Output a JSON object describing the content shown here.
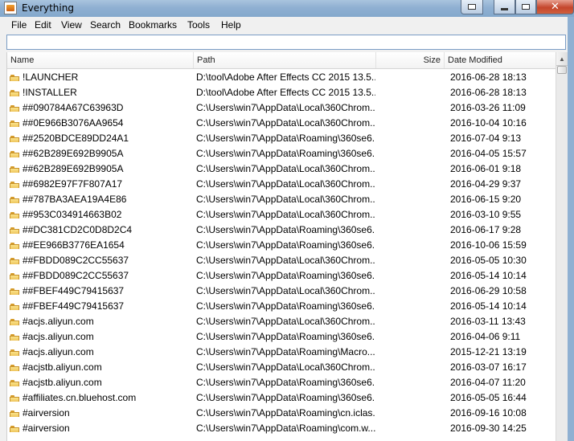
{
  "window": {
    "title": "Everything"
  },
  "menu": [
    "File",
    "Edit",
    "View",
    "Search",
    "Bookmarks",
    "Tools",
    "Help"
  ],
  "search": {
    "value": "",
    "placeholder": ""
  },
  "columns": {
    "name": "Name",
    "path": "Path",
    "size": "Size",
    "date": "Date Modified"
  },
  "rows": [
    {
      "name": "!LAUNCHER",
      "path": "D:\\tool\\Adobe After Effects CC 2015 13.5...",
      "date": "2016-06-28 18:13"
    },
    {
      "name": "!INSTALLER",
      "path": "D:\\tool\\Adobe After Effects CC 2015 13.5...",
      "date": "2016-06-28 18:13"
    },
    {
      "name": "##090784A67C63963D",
      "path": "C:\\Users\\win7\\AppData\\Local\\360Chrom...",
      "date": "2016-03-26 11:09"
    },
    {
      "name": "##0E966B3076AA9654",
      "path": "C:\\Users\\win7\\AppData\\Local\\360Chrom...",
      "date": "2016-10-04 10:16"
    },
    {
      "name": "##2520BDCE89DD24A1",
      "path": "C:\\Users\\win7\\AppData\\Roaming\\360se6...",
      "date": "2016-07-04 9:13"
    },
    {
      "name": "##62B289E692B9905A",
      "path": "C:\\Users\\win7\\AppData\\Roaming\\360se6...",
      "date": "2016-04-05 15:57"
    },
    {
      "name": "##62B289E692B9905A",
      "path": "C:\\Users\\win7\\AppData\\Local\\360Chrom...",
      "date": "2016-06-01 9:18"
    },
    {
      "name": "##6982E97F7F807A17",
      "path": "C:\\Users\\win7\\AppData\\Local\\360Chrom...",
      "date": "2016-04-29 9:37"
    },
    {
      "name": "##787BA3AEA19A4E86",
      "path": "C:\\Users\\win7\\AppData\\Local\\360Chrom...",
      "date": "2016-06-15 9:20"
    },
    {
      "name": "##953C034914663B02",
      "path": "C:\\Users\\win7\\AppData\\Local\\360Chrom...",
      "date": "2016-03-10 9:55"
    },
    {
      "name": "##DC381CD2C0D8D2C4",
      "path": "C:\\Users\\win7\\AppData\\Roaming\\360se6...",
      "date": "2016-06-17 9:28"
    },
    {
      "name": "##EE966B3776EA1654",
      "path": "C:\\Users\\win7\\AppData\\Roaming\\360se6...",
      "date": "2016-10-06 15:59"
    },
    {
      "name": "##FBDD089C2CC55637",
      "path": "C:\\Users\\win7\\AppData\\Local\\360Chrom...",
      "date": "2016-05-05 10:30"
    },
    {
      "name": "##FBDD089C2CC55637",
      "path": "C:\\Users\\win7\\AppData\\Roaming\\360se6...",
      "date": "2016-05-14 10:14"
    },
    {
      "name": "##FBEF449C79415637",
      "path": "C:\\Users\\win7\\AppData\\Local\\360Chrom...",
      "date": "2016-06-29 10:58"
    },
    {
      "name": "##FBEF449C79415637",
      "path": "C:\\Users\\win7\\AppData\\Roaming\\360se6...",
      "date": "2016-05-14 10:14"
    },
    {
      "name": "#acjs.aliyun.com",
      "path": "C:\\Users\\win7\\AppData\\Local\\360Chrom...",
      "date": "2016-03-11 13:43"
    },
    {
      "name": "#acjs.aliyun.com",
      "path": "C:\\Users\\win7\\AppData\\Roaming\\360se6...",
      "date": "2016-04-06 9:11"
    },
    {
      "name": "#acjs.aliyun.com",
      "path": "C:\\Users\\win7\\AppData\\Roaming\\Macro...",
      "date": "2015-12-21 13:19"
    },
    {
      "name": "#acjstb.aliyun.com",
      "path": "C:\\Users\\win7\\AppData\\Local\\360Chrom...",
      "date": "2016-03-07 16:17"
    },
    {
      "name": "#acjstb.aliyun.com",
      "path": "C:\\Users\\win7\\AppData\\Roaming\\360se6...",
      "date": "2016-04-07 11:20"
    },
    {
      "name": "#affiliates.cn.bluehost.com",
      "path": "C:\\Users\\win7\\AppData\\Roaming\\360se6...",
      "date": "2016-05-05 16:44"
    },
    {
      "name": "#airversion",
      "path": "C:\\Users\\win7\\AppData\\Roaming\\cn.iclas...",
      "date": "2016-09-16 10:08"
    },
    {
      "name": "#airversion",
      "path": "C:\\Users\\win7\\AppData\\Roaming\\com.w...",
      "date": "2016-09-30 14:25"
    }
  ],
  "icons": {
    "row": "folder-icon"
  }
}
